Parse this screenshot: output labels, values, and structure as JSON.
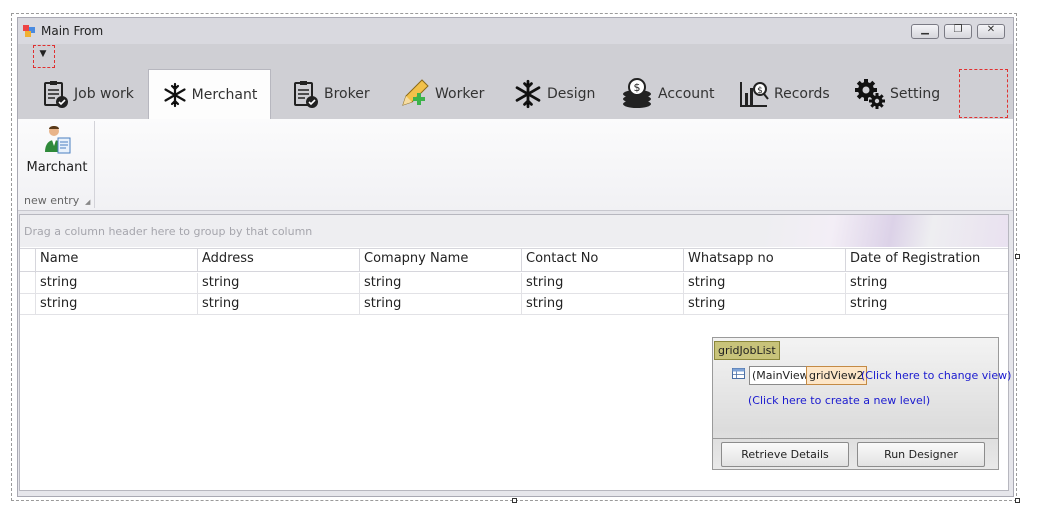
{
  "window": {
    "title": "Main From"
  },
  "ribbon": {
    "tabs": [
      {
        "label": "Job work",
        "icon": "clipboard-check-icon"
      },
      {
        "label": "Merchant",
        "icon": "snowflake-icon",
        "active": true
      },
      {
        "label": "Broker",
        "icon": "clipboard-check-icon"
      },
      {
        "label": "Worker",
        "icon": "pencil-plus-icon"
      },
      {
        "label": "Design",
        "icon": "snowflake-icon"
      },
      {
        "label": "Account",
        "icon": "coins-icon"
      },
      {
        "label": "Records",
        "icon": "chart-money-icon"
      },
      {
        "label": "Setting",
        "icon": "gears-icon"
      }
    ],
    "page": {
      "button_label": "Marchant",
      "button_icon": "person-document-icon",
      "group_caption": "new entry"
    }
  },
  "grid": {
    "group_panel_text": "Drag a column header here to group by that column",
    "columns": [
      "Name",
      "Address",
      "Comapny Name",
      "Contact No",
      "Whatsapp no",
      "Date of Registration"
    ],
    "rows": [
      [
        "string",
        "string",
        "string",
        "string",
        "string",
        "string"
      ],
      [
        "string",
        "string",
        "string",
        "string",
        "string",
        "string"
      ]
    ]
  },
  "designer": {
    "grid_name": "gridJobList",
    "main_view": "(MainView)",
    "view_name": "gridView2",
    "change_view_link": "(Click here to change view)",
    "new_level_link": "(Click here to create a new level)",
    "retrieve_button": "Retrieve Details",
    "run_button": "Run Designer"
  },
  "colors": {
    "ribbon_bg": "#cfcfd4",
    "selection_dash": "#e03030",
    "designer_label_bg": "#c8c37a",
    "link": "#1a1acf"
  }
}
